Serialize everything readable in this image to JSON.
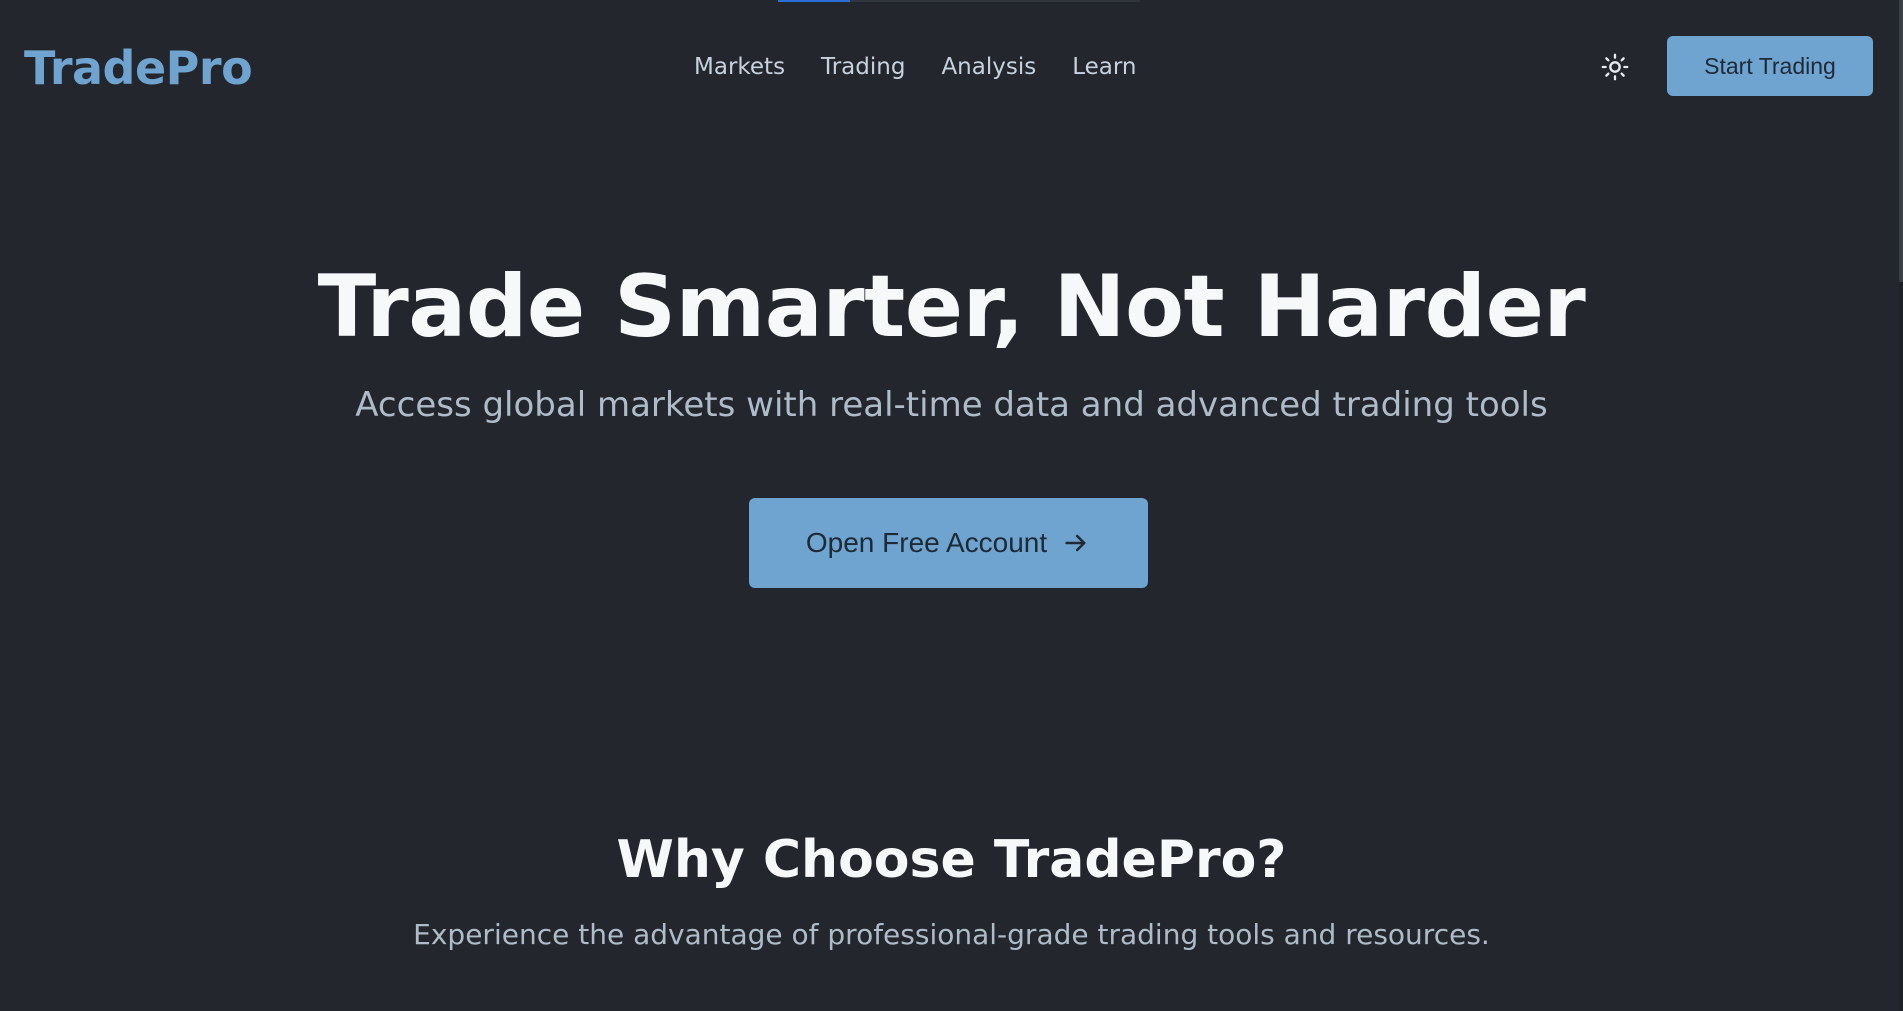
{
  "brand": {
    "name": "TradePro",
    "accent_color": "#6ea4cf",
    "background_color": "#23262c"
  },
  "header": {
    "nav": [
      {
        "label": "Markets"
      },
      {
        "label": "Trading"
      },
      {
        "label": "Analysis"
      },
      {
        "label": "Learn"
      }
    ],
    "theme_toggle_icon": "sun-icon",
    "cta_label": "Start Trading"
  },
  "top_progress": {
    "fill_fraction": 0.2
  },
  "hero": {
    "title": "Trade Smarter, Not Harder",
    "subtitle": "Access global markets with real-time data and advanced trading tools",
    "cta_label": "Open Free Account",
    "cta_icon": "arrow-right-icon"
  },
  "features": {
    "title": "Why Choose TradePro?",
    "subtitle": "Experience the advantage of professional-grade trading tools and resources."
  }
}
